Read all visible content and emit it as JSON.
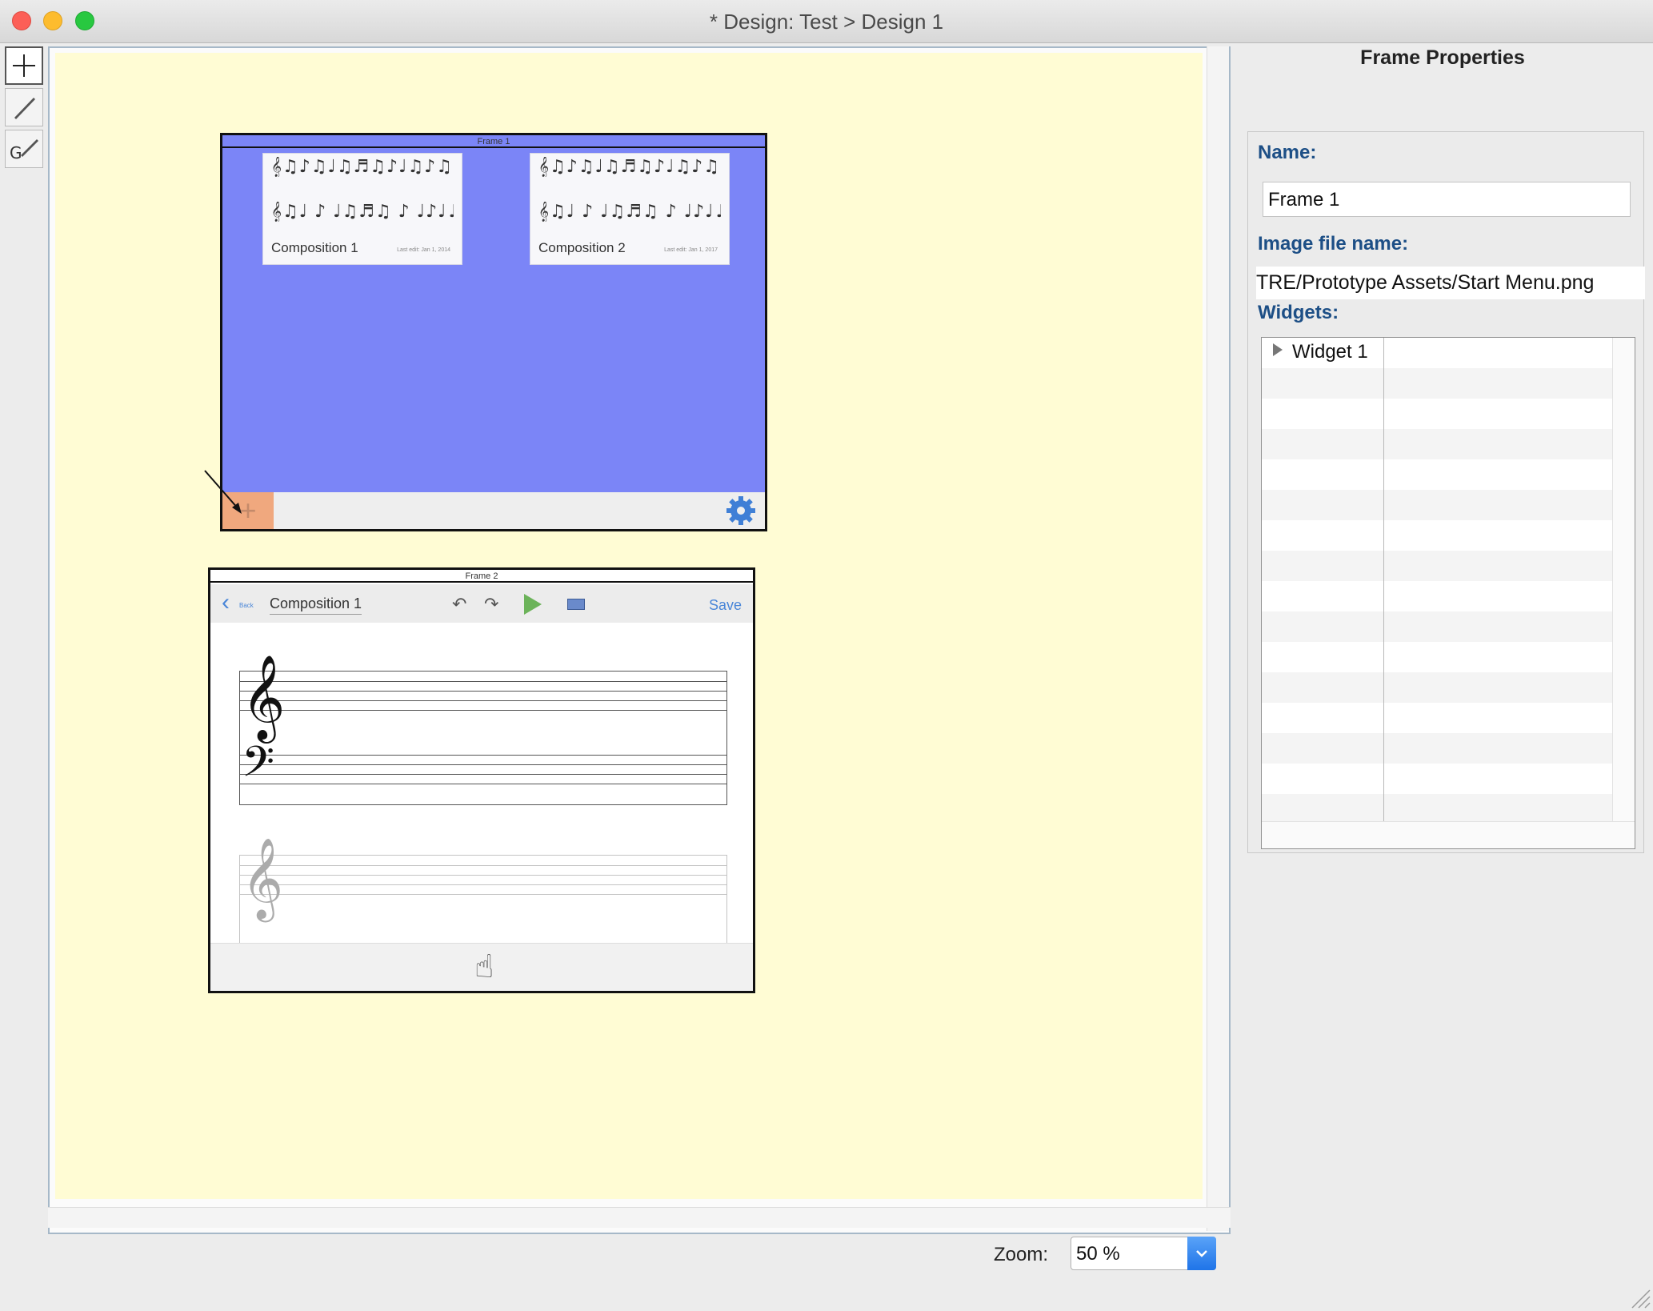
{
  "window": {
    "title": "* Design: Test > Design 1"
  },
  "tools": [
    {
      "name": "add-tool-icon"
    },
    {
      "name": "pencil-tool-icon"
    },
    {
      "name": "gesture-tool-icon"
    }
  ],
  "canvas": {
    "frame1": {
      "label": "Frame 1",
      "cards": [
        {
          "name": "Composition 1",
          "date": "Last edit: Jan 1, 2014"
        },
        {
          "name": "Composition 2",
          "date": "Last edit: Jan 1, 2017"
        }
      ],
      "add_symbol": "+",
      "colors": {
        "background": "#7b85f7",
        "add_button": "#f0a87e",
        "gear": "#3f7fd6"
      }
    },
    "frame2": {
      "label": "Frame 2",
      "back_label": "Back",
      "composition_title": "Composition 1",
      "save_label": "Save",
      "colors": {
        "play": "#6cb35a",
        "link": "#4a86d8"
      }
    }
  },
  "properties": {
    "title": "Frame Properties",
    "name_label": "Name:",
    "name_value": "Frame 1",
    "image_label": "Image file name:",
    "image_value": "TRE/Prototype Assets/Start Menu.png",
    "widgets_label": "Widgets:",
    "widgets": [
      "Widget 1"
    ]
  },
  "zoom": {
    "label": "Zoom:",
    "value": "50 %"
  },
  "colors": {
    "canvas_bg": "#fffcd4",
    "accent": "#1d4f86"
  }
}
